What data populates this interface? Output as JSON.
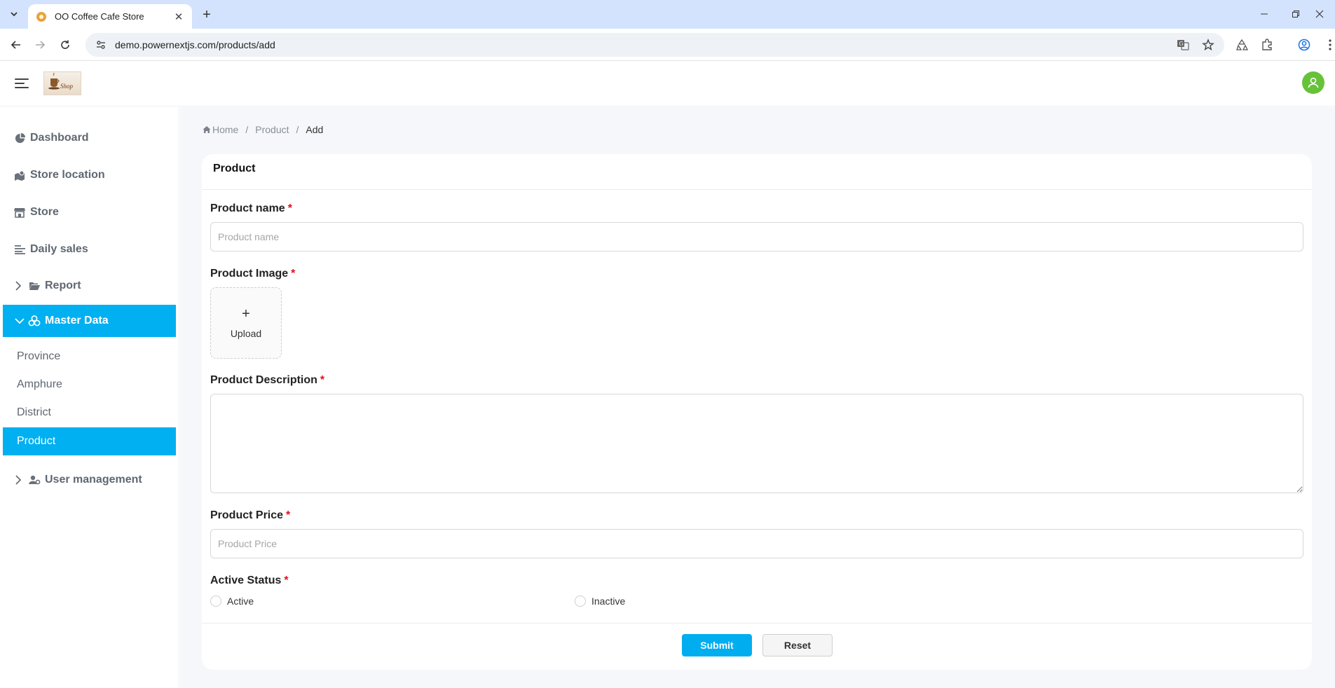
{
  "browser": {
    "tab_title": "OO Coffee Cafe Store",
    "url": "demo.powernextjs.com/products/add"
  },
  "sidebar": {
    "items": [
      {
        "label": "Dashboard",
        "icon": "pie-chart-icon"
      },
      {
        "label": "Store location",
        "icon": "map-location-icon"
      },
      {
        "label": "Store",
        "icon": "store-icon"
      },
      {
        "label": "Daily sales",
        "icon": "list-lines-icon"
      },
      {
        "label": "Report",
        "icon": "folder-open-icon",
        "expandable": true,
        "expanded": false
      },
      {
        "label": "Master Data",
        "icon": "cubes-icon",
        "expandable": true,
        "expanded": true,
        "active": true
      },
      {
        "label": "User management",
        "icon": "user-gear-icon",
        "expandable": true,
        "expanded": false
      }
    ],
    "master_data_children": [
      "Province",
      "Amphure",
      "District",
      "Product"
    ],
    "active_child": "Product"
  },
  "breadcrumb": {
    "home": "Home",
    "section": "Product",
    "current": "Add"
  },
  "form": {
    "card_title": "Product",
    "product_name": {
      "label": "Product name",
      "required": "*",
      "placeholder": "Product name",
      "value": ""
    },
    "product_image": {
      "label": "Product Image",
      "required": "*",
      "upload_label": "Upload",
      "upload_symbol": "+"
    },
    "product_description": {
      "label": "Product Description",
      "required": "*",
      "value": ""
    },
    "product_price": {
      "label": "Product Price",
      "required": "*",
      "placeholder": "Product Price",
      "value": ""
    },
    "active_status": {
      "label": "Active Status",
      "required": "*",
      "options": [
        "Active",
        "Inactive"
      ],
      "selected": null
    },
    "submit_label": "Submit",
    "reset_label": "Reset"
  },
  "colors": {
    "accent": "#00b0f0",
    "required": "#e0101e",
    "avatar": "#67c23a"
  }
}
